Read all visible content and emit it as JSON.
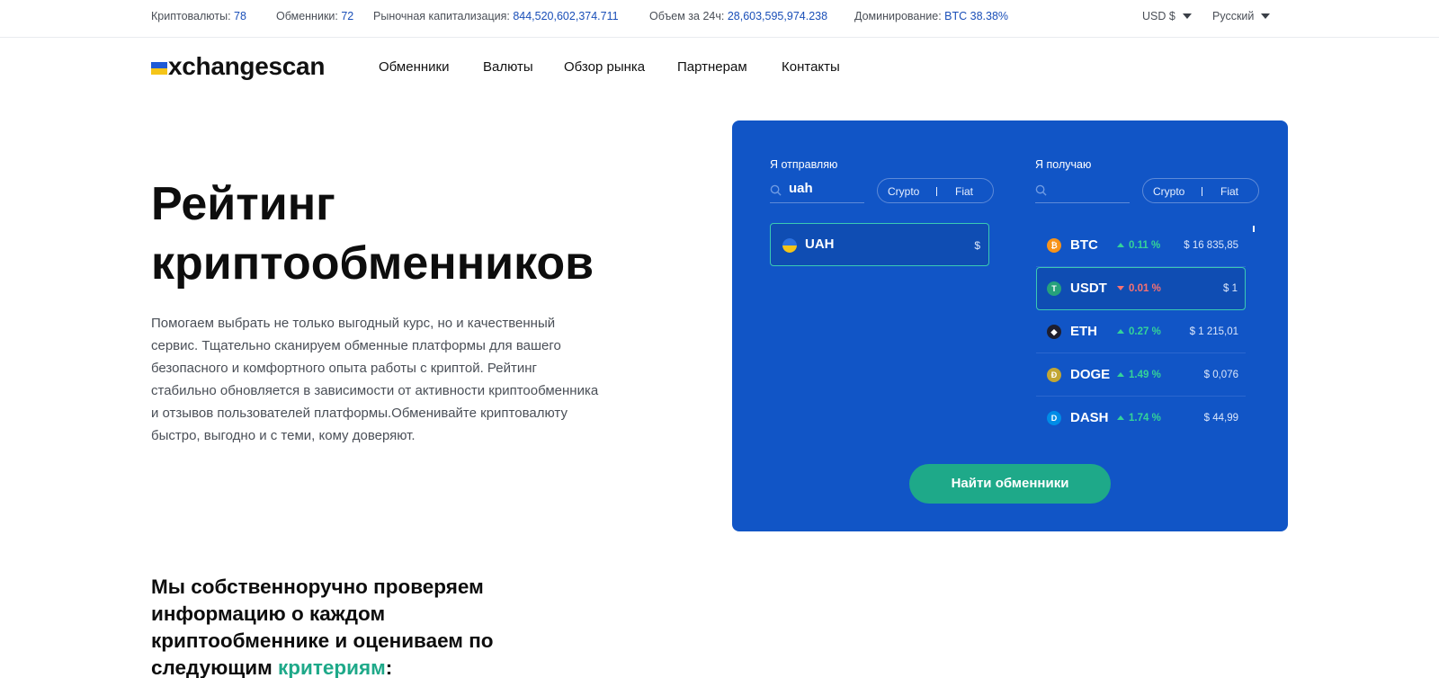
{
  "topbar": {
    "cryptos_label": "Криптовалюты:",
    "cryptos_value": "78",
    "exchangers_label": "Обменники:",
    "exchangers_value": "72",
    "market_cap_label": "Рыночная капитализация:",
    "market_cap_value": "844,520,602,374.711",
    "volume_label": "Объем за 24ч:",
    "volume_value": "28,603,595,974.238",
    "dominance_label": "Доминирование:",
    "dominance_value": "BTC 38.38%",
    "currency": "USD $",
    "language": "Русский"
  },
  "logo": {
    "text": "xchangescan",
    "flag_top": "#1f5bd6",
    "flag_bottom": "#f5c518"
  },
  "nav": {
    "items": [
      "Обменники",
      "Валюты",
      "Обзор рынка",
      "Партнерам",
      "Контакты"
    ]
  },
  "hero": {
    "title_line1": "Рейтинг",
    "title_line2": "криптообменников",
    "description": "Помогаем выбрать не только выгодный курс, но и качественный сервис. Тщательно сканируем обменные платформы для вашего безопасного и комфортного опыта работы с криптой. Рейтинг стабильно обновляется в зависимости от активности криптообменника и отзывов пользователей платформы.Обменивайте криптовалюту быстро, выгодно и с теми, кому доверяют."
  },
  "exchange": {
    "send": {
      "label": "Я отправляю",
      "search_value": "uah",
      "toggle_crypto": "Crypto",
      "toggle_fiat": "Fiat",
      "selected": {
        "symbol": "UAH",
        "currency_sign": "$",
        "icon": "ukraine-flag-icon"
      }
    },
    "receive": {
      "label": "Я получаю",
      "search_value": "",
      "toggle_crypto": "Crypto",
      "toggle_fiat": "Fiat",
      "coins": [
        {
          "symbol": "BTC",
          "change": "0.11 %",
          "direction": "up",
          "price": "$ 16 835,85",
          "icon": "bitcoin-icon",
          "color": "#f7931a"
        },
        {
          "symbol": "USDT",
          "change": "0.01 %",
          "direction": "down",
          "price": "$ 1",
          "icon": "tether-icon",
          "color": "#26a17b"
        },
        {
          "symbol": "ETH",
          "change": "0.27 %",
          "direction": "up",
          "price": "$ 1 215,01",
          "icon": "ethereum-icon",
          "color": "#1e1e2e"
        },
        {
          "symbol": "DOGE",
          "change": "1.49 %",
          "direction": "up",
          "price": "$ 0,076",
          "icon": "dogecoin-icon",
          "color": "#c2a633"
        },
        {
          "symbol": "DASH",
          "change": "1.74 %",
          "direction": "up",
          "price": "$ 44,99",
          "icon": "dash-icon",
          "color": "#008ce7"
        }
      ]
    },
    "find_button": "Найти обменники"
  },
  "criteria": {
    "title_prefix": "Мы собственноручно проверяем информацию о каждом криптообменнике и оцениваем по следующим",
    "title_highlight": "критериям",
    "title_suffix": ":"
  },
  "colors": {
    "panel": "#1155c6",
    "accent_green": "#1ea989",
    "link_blue": "#1a4fb8"
  }
}
